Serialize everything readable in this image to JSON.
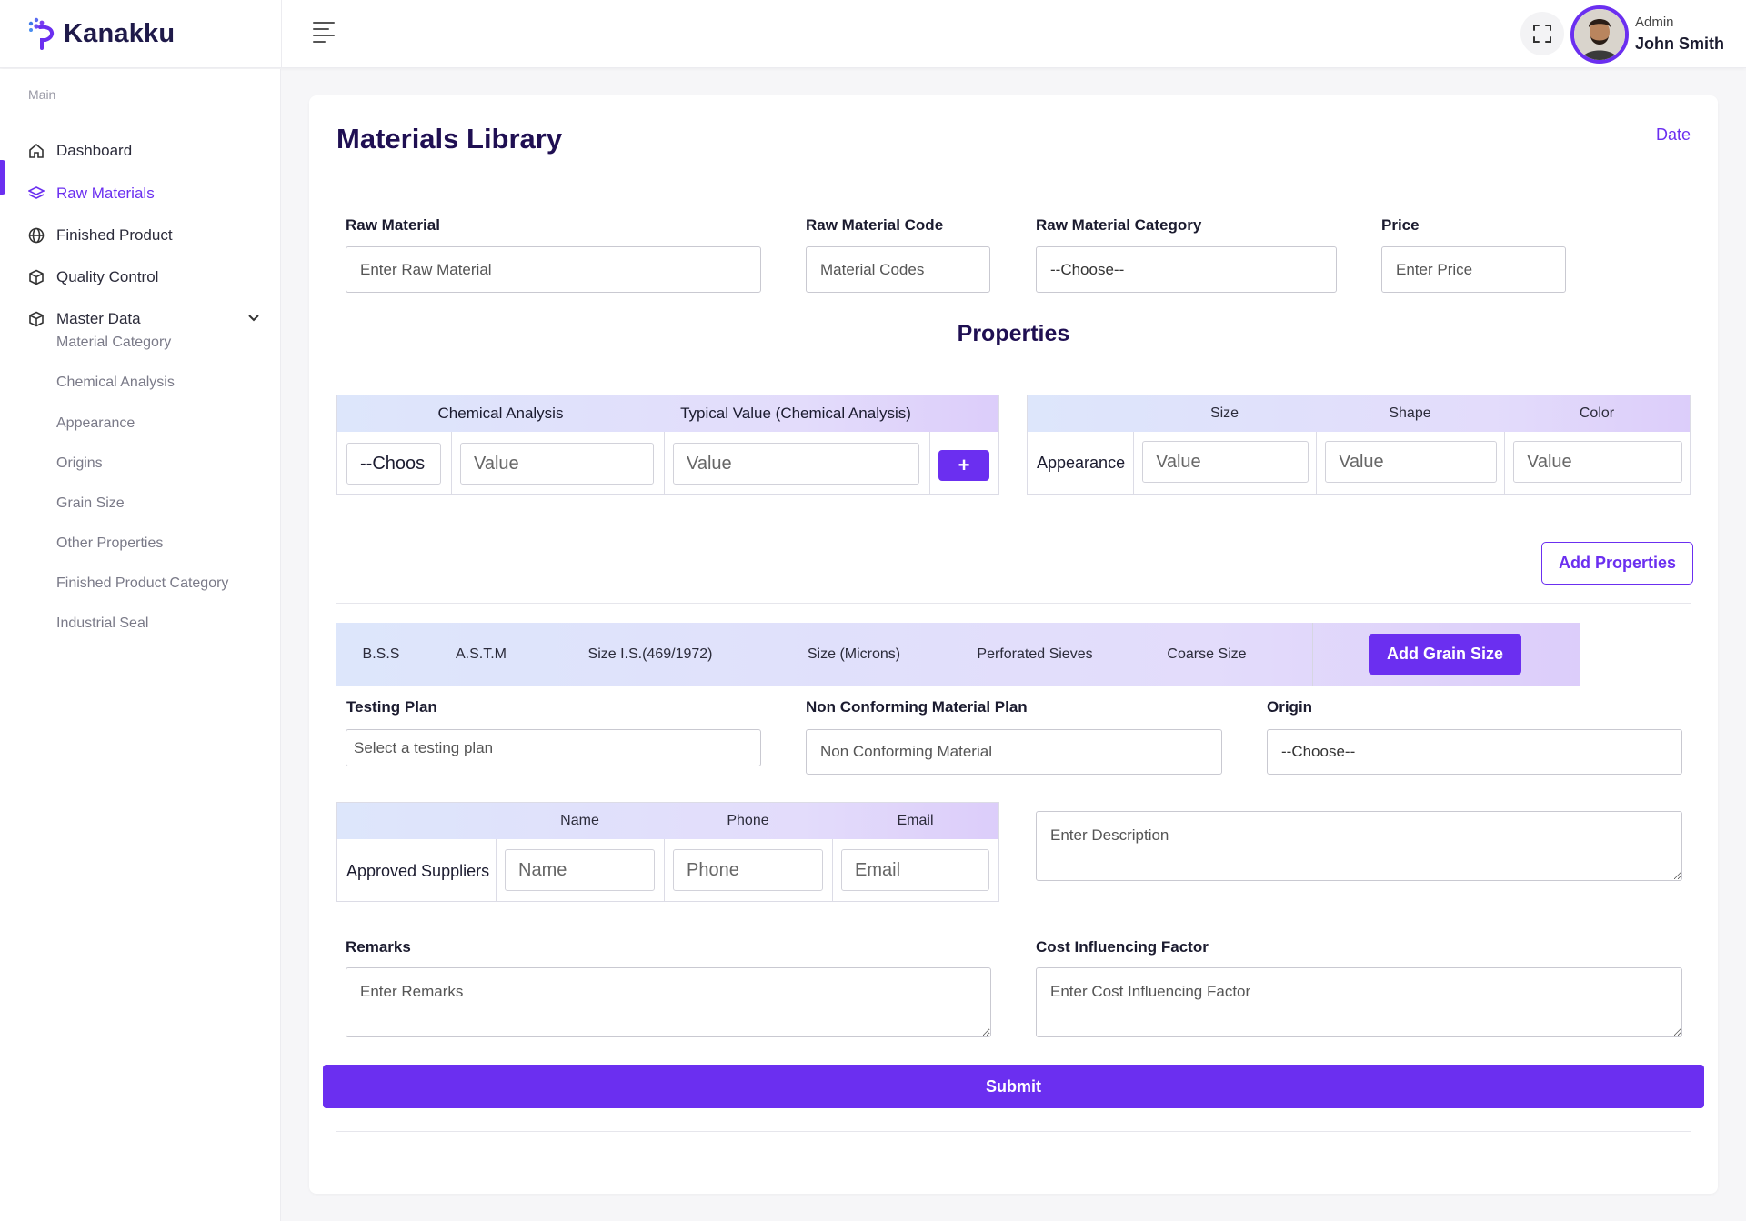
{
  "app": {
    "name": "Kanakku"
  },
  "header": {
    "user_role": "Admin",
    "user_name": "John Smith"
  },
  "sidebar": {
    "section": "Main",
    "items": [
      {
        "label": "Dashboard",
        "icon": "home-icon"
      },
      {
        "label": "Raw Materials",
        "icon": "layers-icon",
        "active": true
      },
      {
        "label": "Finished Product",
        "icon": "globe-icon"
      },
      {
        "label": "Quality Control",
        "icon": "box-icon"
      },
      {
        "label": "Master Data",
        "icon": "box-icon",
        "expanded": true
      }
    ],
    "subitems": [
      "Material Category",
      "Chemical Analysis",
      "Appearance",
      "Origins",
      "Grain Size",
      "Other Properties",
      "Finished Product Category",
      "Industrial Seal"
    ]
  },
  "page": {
    "title": "Materials Library",
    "date_label": "Date"
  },
  "form": {
    "raw_material": {
      "label": "Raw Material",
      "placeholder": "Enter Raw Material"
    },
    "raw_material_code": {
      "label": "Raw Material Code",
      "placeholder": "Material Codes"
    },
    "raw_material_category": {
      "label": "Raw Material Category",
      "value": "--Choose--"
    },
    "price": {
      "label": "Price",
      "placeholder": "Enter Price"
    },
    "properties_title": "Properties",
    "chemical_table": {
      "headers": [
        "Chemical Analysis",
        "Typical Value (Chemical Analysis)"
      ],
      "select_value": "--Choos",
      "value_placeholder": "Value",
      "typical_placeholder": "Value",
      "add_label": "+"
    },
    "appearance_table": {
      "headers": [
        "Size",
        "Shape",
        "Color"
      ],
      "row_label": "Appearance",
      "placeholders": [
        "Value",
        "Value",
        "Value"
      ]
    },
    "add_properties_label": "Add Properties",
    "grain_columns": [
      "B.S.S",
      "A.S.T.M",
      "Size I.S.(469/1972)",
      "Size (Microns)",
      "Perforated Sieves",
      "Coarse Size"
    ],
    "add_grain_label": "Add Grain Size",
    "testing_plan": {
      "label": "Testing Plan",
      "placeholder": "Select a testing plan"
    },
    "non_conforming": {
      "label": "Non Conforming Material Plan",
      "placeholder": "Non Conforming Material"
    },
    "origin": {
      "label": "Origin",
      "value": "--Choose--"
    },
    "suppliers_table": {
      "headers": [
        "Name",
        "Phone",
        "Email"
      ],
      "row_label": "Approved Suppliers",
      "placeholders": [
        "Name",
        "Phone",
        "Email"
      ]
    },
    "description": {
      "placeholder": "Enter Description"
    },
    "remarks": {
      "label": "Remarks",
      "placeholder": "Enter Remarks"
    },
    "cost_factor": {
      "label": "Cost Influencing Factor",
      "placeholder": "Enter Cost Influencing Factor"
    },
    "submit_label": "Submit"
  },
  "colors": {
    "accent": "#6b2ff0",
    "title": "#1f0f52"
  }
}
